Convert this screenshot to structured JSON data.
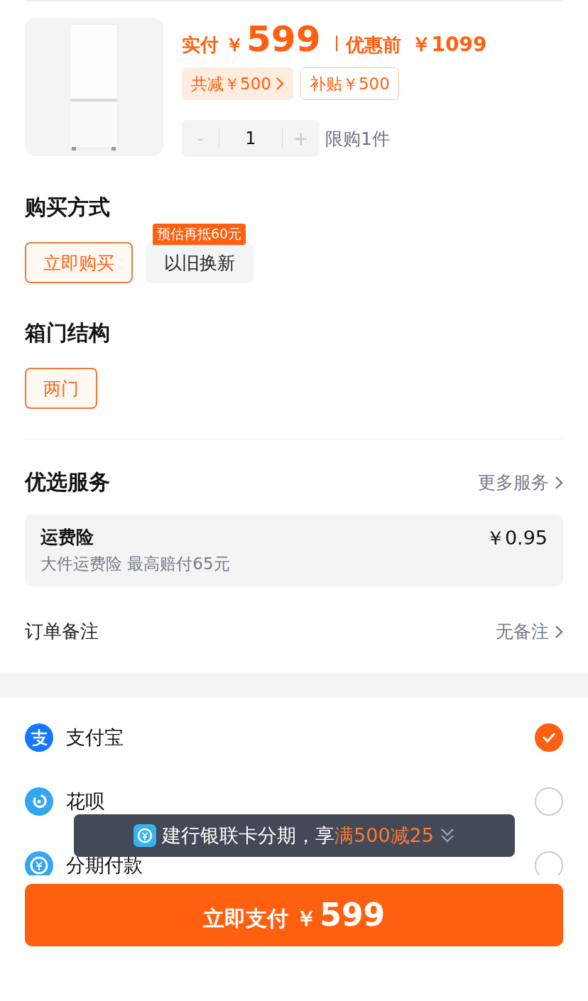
{
  "product": {
    "kind": "picture",
    "paid_label": "实付 ￥",
    "paid_amount": "599",
    "original_label": "优惠前",
    "original_price": "￥1099",
    "tags": [
      {
        "kind": "discount",
        "text": "共减￥500"
      },
      {
        "kind": "outline",
        "text": "补贴￥500"
      }
    ],
    "stepper": {
      "minus": "-",
      "value": "1",
      "plus": "+",
      "disabled_minus": true,
      "disabled_plus": true
    },
    "limit": "限购1件"
  },
  "purchase_method": {
    "title": "购买方式",
    "options": [
      {
        "label": "立即购买",
        "selected": true
      },
      {
        "label": "以旧换新",
        "selected": false,
        "badge": "预估再抵60元"
      }
    ]
  },
  "door_structure": {
    "title": "箱门结构",
    "options": [
      {
        "label": "两门",
        "selected": true
      }
    ]
  },
  "services": {
    "title": "优选服务",
    "more": "更多服务",
    "items": [
      {
        "name": "运费险",
        "description": "大件运费险 最高赔付65元",
        "price": "￥0.95"
      }
    ]
  },
  "order_note": {
    "label": "订单备注",
    "value": "无备注"
  },
  "payment_methods": [
    {
      "kind": "alipay",
      "label": "支付宝",
      "selected": true
    },
    {
      "kind": "huabei",
      "label": "花呗",
      "selected": false
    },
    {
      "kind": "installment",
      "label": "分期付款",
      "selected": false
    }
  ],
  "toast": {
    "text": "建行银联卡分期，享",
    "highlight": "满500减25"
  },
  "pay_button": {
    "label": "立即支付 ￥",
    "amount": "599"
  }
}
